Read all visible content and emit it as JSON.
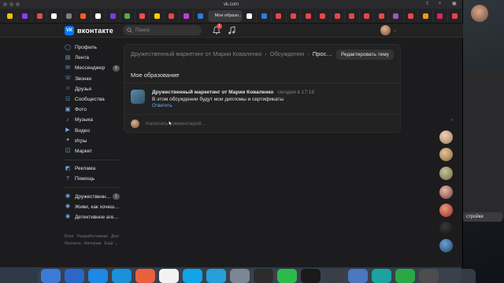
{
  "browser": {
    "url": "vk.com",
    "active_tab_label": "Мое образо…",
    "tab_colors": [
      "#f2c200",
      "#8f3df0",
      "#e34b4b",
      "#ffffff",
      "#7f7f7f",
      "#ff5c2a",
      "#ffffff",
      "#7a3dd9",
      "#4cae4c",
      "#ff4a4a",
      "#ffcc00",
      "#e64646",
      "#c13ddb",
      "#2a7cde",
      "#ffffff",
      "#2a7cde",
      "#e64646",
      "#e64646",
      "#e64646",
      "#e64646",
      "#e64646",
      "#e64646",
      "#e64646",
      "#e64646",
      "#9b59b6",
      "#e64646",
      "#f39c12",
      "#e91e63",
      "#e64646"
    ]
  },
  "header": {
    "logo_text": "вконтакте",
    "logo_mark": "VK",
    "search_placeholder": "Поиск",
    "notifications_count": "1"
  },
  "nav": {
    "items": [
      {
        "label": "Профиль",
        "icon": "profile-icon"
      },
      {
        "label": "Лента",
        "icon": "feed-icon"
      },
      {
        "label": "Мессенджер",
        "icon": "messenger-icon",
        "count": "6"
      },
      {
        "label": "Звонки",
        "icon": "calls-icon"
      },
      {
        "label": "Друзья",
        "icon": "friends-icon"
      },
      {
        "label": "Сообщества",
        "icon": "communities-icon"
      },
      {
        "label": "Фото",
        "icon": "photo-icon"
      },
      {
        "label": "Музыка",
        "icon": "music-icon"
      },
      {
        "label": "Видео",
        "icon": "video-icon"
      },
      {
        "label": "Игры",
        "icon": "games-icon"
      },
      {
        "label": "Маркет",
        "icon": "market-icon"
      }
    ],
    "items2": [
      {
        "label": "Реклама",
        "icon": "ads-icon"
      },
      {
        "label": "Помощь",
        "icon": "help-icon"
      }
    ],
    "items3": [
      {
        "label": "Дружественн…",
        "icon": "group-icon",
        "count": "1"
      },
      {
        "label": "Живи, как хочеш…",
        "icon": "group-icon"
      },
      {
        "label": "Детективное аге…",
        "icon": "group-icon"
      }
    ],
    "footer": [
      "Блог",
      "Разработчикам",
      "Для бизнеса",
      "Авторам",
      "Ещё ⌄"
    ]
  },
  "topic": {
    "breadcrumbs": [
      "Дружественный маркетинг от Марии Коваленко",
      "Обсуждения",
      "Прос…"
    ],
    "edit_button": "Редактировать тему",
    "title": "Мое образование",
    "post": {
      "author": "Дружественный маркетинг от Марии Коваленко",
      "time": "сегодня в 17:18",
      "text": "В этом обсуждении будут мои дипломы и сертификаты",
      "reply_label": "Ответить"
    },
    "comment_placeholder": "Написать комментарий…"
  },
  "desktop": {
    "settings_label": "стройки"
  }
}
